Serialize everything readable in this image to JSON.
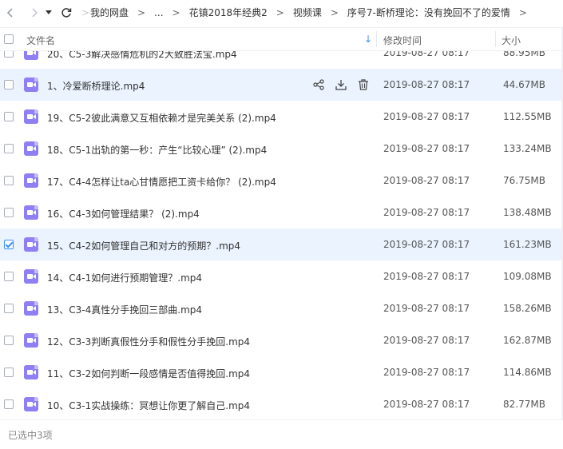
{
  "nav": {
    "back_icon": "chevron-left-icon",
    "forward_icon": "chevron-right-icon",
    "dropdown_icon": "caret-down-icon",
    "refresh_icon": "refresh-icon"
  },
  "breadcrumb": {
    "items": [
      "我的网盘",
      "...",
      "花镇2018年经典2",
      "视频课",
      "序号7-断桥理论：没有挽回不了的爱情"
    ],
    "separator": ">"
  },
  "header": {
    "name": "文件名",
    "sort_indicator": "↓",
    "mtime": "修改时间",
    "size": "大小"
  },
  "files": [
    {
      "name": "20、C5-3解决感情危机的2大致胜法宝.mp4",
      "mtime": "2019-08-27 08:17",
      "size": "88.95MB",
      "checked": false,
      "hover": false
    },
    {
      "name": "1、冷爱断桥理论.mp4",
      "mtime": "2019-08-27 08:17",
      "size": "44.67MB",
      "checked": false,
      "hover": true
    },
    {
      "name": "19、C5-2彼此满意又互相依赖才是完美关系 (2).mp4",
      "mtime": "2019-08-27 08:17",
      "size": "112.55MB",
      "checked": false,
      "hover": false
    },
    {
      "name": "18、C5-1出轨的第一秒：产生“比较心理” (2).mp4",
      "mtime": "2019-08-27 08:17",
      "size": "133.24MB",
      "checked": false,
      "hover": false
    },
    {
      "name": "17、C4-4怎样让ta心甘情愿把工资卡给你？ (2).mp4",
      "mtime": "2019-08-27 08:17",
      "size": "76.75MB",
      "checked": false,
      "hover": false
    },
    {
      "name": "16、C4-3如何管理结果？ (2).mp4",
      "mtime": "2019-08-27 08:17",
      "size": "138.48MB",
      "checked": false,
      "hover": false
    },
    {
      "name": "15、C4-2如何管理自己和对方的预期？.mp4",
      "mtime": "2019-08-27 08:17",
      "size": "161.23MB",
      "checked": true,
      "hover": false
    },
    {
      "name": "14、C4-1如何进行预期管理？.mp4",
      "mtime": "2019-08-27 08:17",
      "size": "109.08MB",
      "checked": false,
      "hover": false
    },
    {
      "name": "13、C3-4真性分手挽回三部曲.mp4",
      "mtime": "2019-08-27 08:17",
      "size": "158.26MB",
      "checked": false,
      "hover": false
    },
    {
      "name": "12、C3-3判断真假性分手和假性分手挽回.mp4",
      "mtime": "2019-08-27 08:17",
      "size": "162.87MB",
      "checked": false,
      "hover": false
    },
    {
      "name": "11、C3-2如何判断一段感情是否值得挽回.mp4",
      "mtime": "2019-08-27 08:17",
      "size": "114.86MB",
      "checked": false,
      "hover": false
    },
    {
      "name": "10、C3-1实战操练：冥想让你更了解自己.mp4",
      "mtime": "2019-08-27 08:17",
      "size": "82.77MB",
      "checked": false,
      "hover": false
    }
  ],
  "row_actions": [
    "share-icon",
    "download-icon",
    "delete-icon"
  ],
  "footer": {
    "status": "已选中3项"
  },
  "colors": {
    "accent": "#3b8cff",
    "row_highlight": "#eaf3fe",
    "video_icon": "#8f7ff5"
  }
}
